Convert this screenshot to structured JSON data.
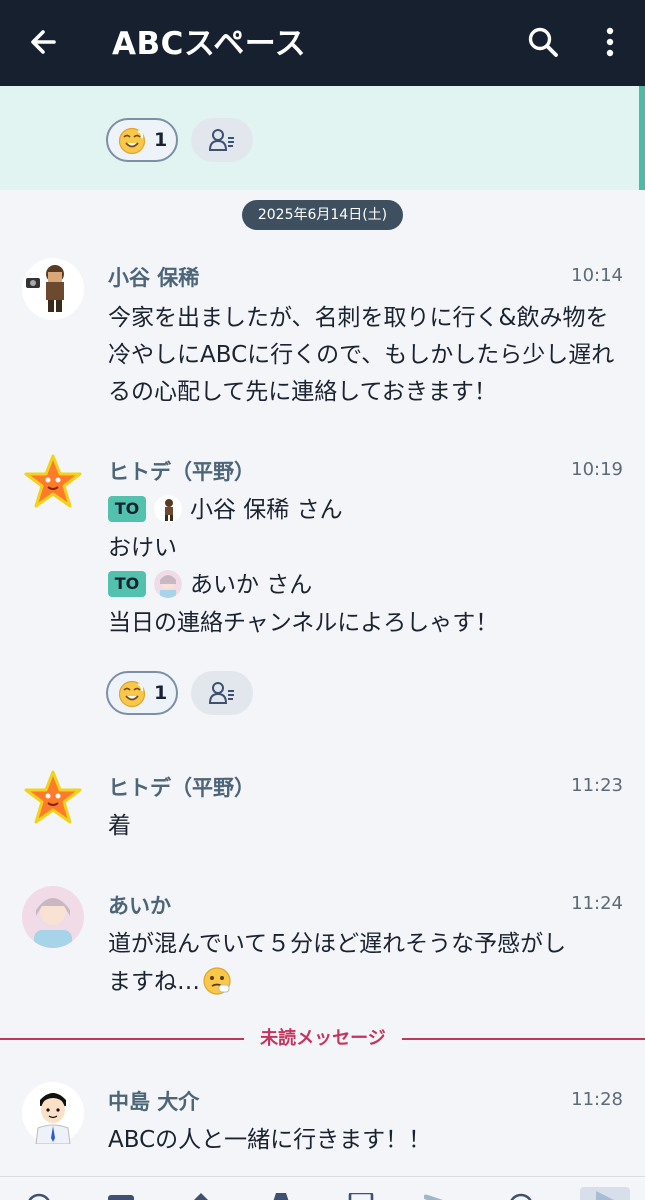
{
  "header": {
    "title": "ABCスペース",
    "back_icon": "arrow-left-icon",
    "search_icon": "search-icon",
    "more_icon": "more-vertical-icon"
  },
  "prev_message": {
    "reaction": {
      "emoji": "smiling-face-emoji",
      "count": "1"
    },
    "readers_icon": "readers-icon"
  },
  "date_separator": "2025年6月14日(土)",
  "messages": [
    {
      "sender": "小谷 保稀",
      "time": "10:14",
      "text": "今家を出ましたが、名刺を取りに行く&飲み物を冷やしにABCに行くので、もしかしたら少し遅れるの心配して先に連絡しておきます！"
    },
    {
      "sender": "ヒトデ（平野）",
      "time": "10:19",
      "lines": [
        {
          "to_badge": "TO",
          "text": "小谷 保稀 さん"
        },
        {
          "text": "おけい"
        },
        {
          "to_badge": "TO",
          "text": "あいか さん"
        },
        {
          "text": "当日の連絡チャンネルによろしゃす！"
        }
      ],
      "reaction": {
        "emoji": "smiling-face-emoji",
        "count": "1"
      }
    },
    {
      "sender": "ヒトデ（平野）",
      "time": "11:23",
      "text": "着"
    },
    {
      "sender": "あいか",
      "time": "11:24",
      "text_line1": "道が混んでいて５分ほど遅れそうな予感がし",
      "text_line2": "ますね…"
    },
    {
      "sender": "中島 大介",
      "time": "11:28",
      "text": "ABCの人と一緒に行きます！！"
    }
  ],
  "unread_label": "未読メッセージ",
  "colors": {
    "header_bg": "#16202e",
    "highlight_bg": "#e2f4f1",
    "accent_teal": "#52c2ae",
    "unread_red": "#c2355d",
    "sender_name": "#4d6578"
  }
}
